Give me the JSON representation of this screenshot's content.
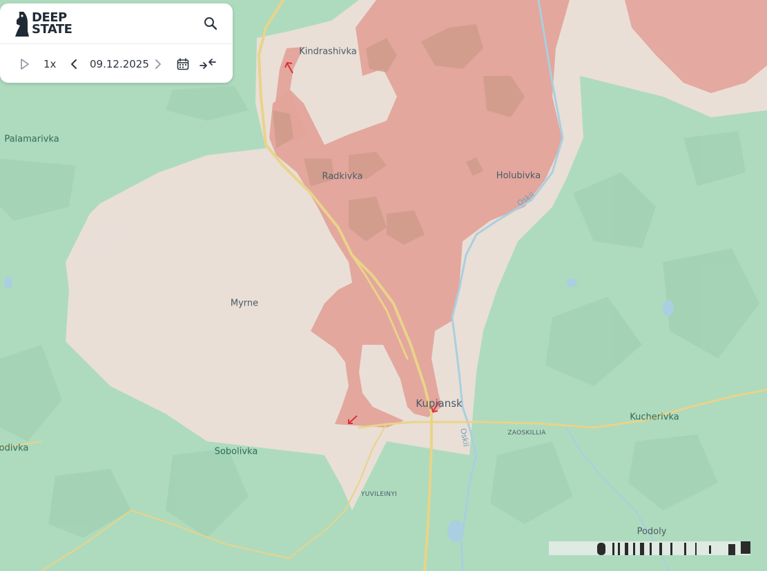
{
  "app": {
    "logo_line1": "DEEP",
    "logo_line2": "STATE"
  },
  "controls": {
    "speed": "1x",
    "date": "09.12.2025"
  },
  "labels": {
    "kindrashivka": "Kindrashivka",
    "palamarivka": "Palamarivka",
    "radkivka": "Radkivka",
    "holubivka": "Holubivka",
    "oskil_north": "Oskil",
    "myrne": "Myrne",
    "kupiansk": "Kupiansk",
    "kucherivka": "Kucherivka",
    "zaoskillia": "ZAOSKILLIA",
    "oskil_south": "Oskil",
    "odivka": "odivka",
    "sobolivka": "Sobolivka",
    "yuvileinyi": "YUVILEINYI",
    "podoly": "Podoly"
  },
  "colors": {
    "forest": "#aedbbe",
    "contested_zone": "#ecdfd7",
    "occupied_zone": "#e3a39a",
    "road": "#e9d38a",
    "water": "#a9cfe0",
    "attack_arrow": "#d8323c"
  },
  "icons": {
    "logo": "knight-chess-icon",
    "search": "search-icon",
    "play": "play-icon",
    "prev": "chevron-left-icon",
    "next": "chevron-right-icon",
    "calendar": "calendar-icon",
    "collapse": "collapse-arrows-icon"
  }
}
